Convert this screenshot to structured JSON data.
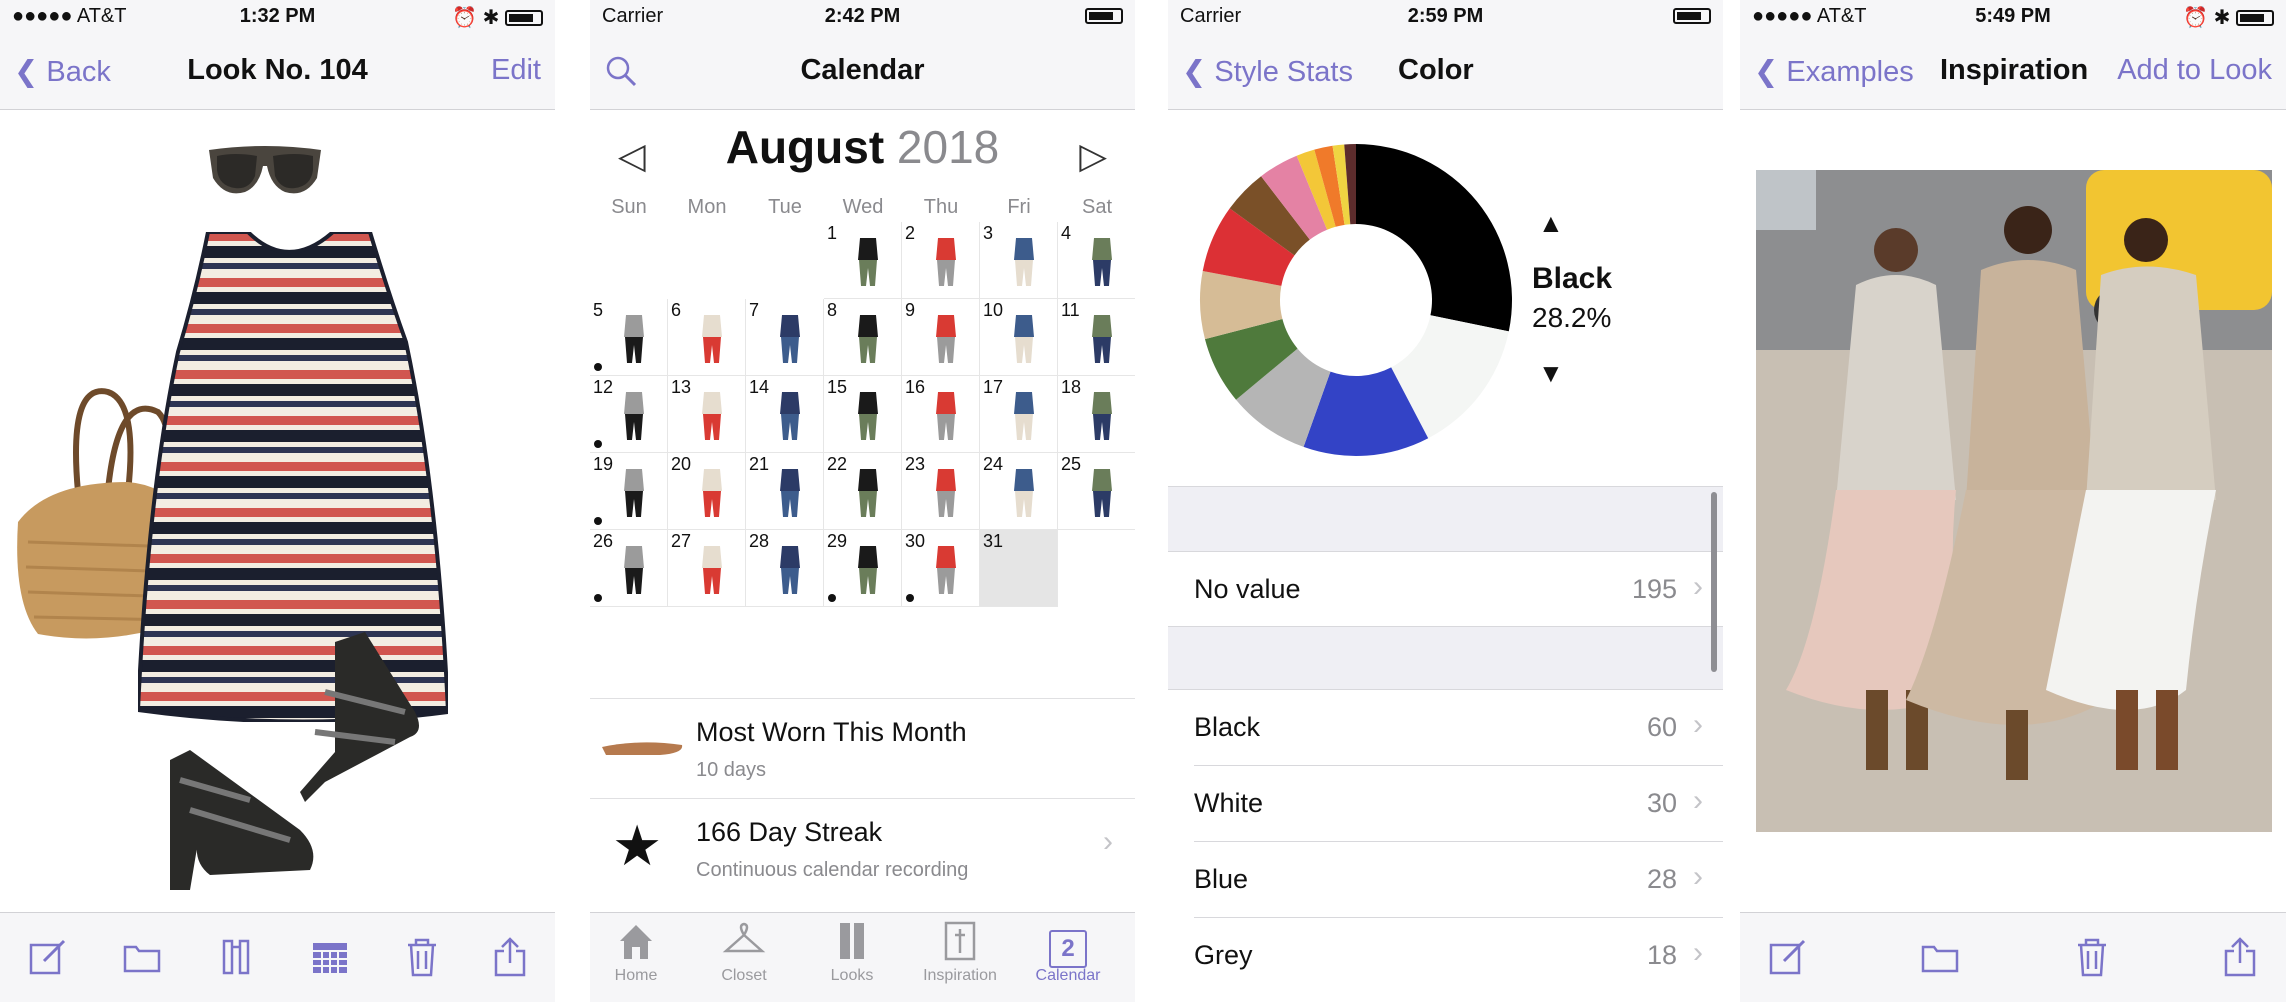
{
  "screens": {
    "look": {
      "status": {
        "carrier": "●●●●● AT&T",
        "time": "1:32 PM"
      },
      "nav": {
        "back": "Back",
        "title": "Look No. 104",
        "edit": "Edit"
      },
      "toolbar_icons": [
        "edit-icon",
        "folder-icon",
        "outfit-icon",
        "calendar-grid-icon",
        "trash-icon",
        "share-icon"
      ]
    },
    "calendar": {
      "status": {
        "carrier": "Carrier",
        "time": "2:42 PM"
      },
      "nav": {
        "title": "Calendar"
      },
      "month": "August",
      "year": "2018",
      "weekdays": [
        "Sun",
        "Mon",
        "Tue",
        "Wed",
        "Thu",
        "Fri",
        "Sat"
      ],
      "days": [
        "1",
        "2",
        "3",
        "4",
        "5",
        "6",
        "7",
        "8",
        "9",
        "10",
        "11",
        "12",
        "13",
        "14",
        "15",
        "16",
        "17",
        "18",
        "19",
        "20",
        "21",
        "22",
        "23",
        "24",
        "25",
        "26",
        "27",
        "28",
        "29",
        "30",
        "31"
      ],
      "most_worn": {
        "title": "Most Worn This Month",
        "sub": "10 days"
      },
      "streak": {
        "title": "166 Day Streak",
        "sub": "Continuous calendar recording"
      },
      "tabs": [
        "Home",
        "Closet",
        "Looks",
        "Inspiration",
        "Calendar"
      ],
      "active_tab": "Calendar",
      "calendar_tab_badge": "2"
    },
    "color": {
      "status": {
        "carrier": "Carrier",
        "time": "2:59 PM"
      },
      "nav": {
        "back": "Style Stats",
        "title": "Color"
      },
      "selected": {
        "name": "Black",
        "percent": "28.2%"
      },
      "no_value": {
        "label": "No value",
        "count": "195"
      },
      "rows": [
        {
          "label": "Black",
          "count": "60"
        },
        {
          "label": "White",
          "count": "30"
        },
        {
          "label": "Blue",
          "count": "28"
        },
        {
          "label": "Grey",
          "count": "18"
        }
      ],
      "accent": "#7b74c9"
    },
    "inspiration": {
      "status": {
        "carrier": "●●●●● AT&T",
        "time": "5:49 PM"
      },
      "nav": {
        "back": "Examples",
        "title": "Inspiration",
        "right": "Add to Look"
      }
    }
  },
  "chart_data": {
    "type": "pie",
    "categories": [
      "Black",
      "White",
      "Blue",
      "Grey",
      "Green",
      "Tan",
      "Red",
      "Brown",
      "Pink",
      "Yellow",
      "Orange",
      "Gold",
      "Dark Red"
    ],
    "values": [
      28.2,
      14.1,
      13.1,
      8.5,
      7.0,
      7.0,
      7.0,
      4.6,
      4.2,
      1.9,
      1.9,
      1.2,
      1.2
    ],
    "colors": [
      "#000000",
      "#f4f6f4",
      "#3343c6",
      "#b5b5b5",
      "#4f7a3c",
      "#d6bc96",
      "#dc3035",
      "#7a5028",
      "#e482a4",
      "#f3c738",
      "#f07a2a",
      "#efd442",
      "#5c2c2c"
    ]
  }
}
